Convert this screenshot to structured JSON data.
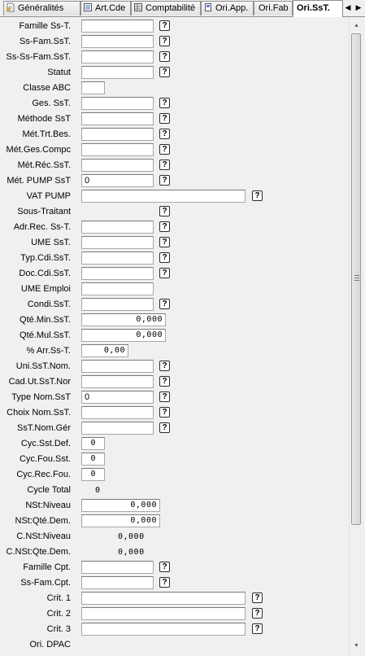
{
  "tabs": [
    {
      "label": "Généralités",
      "icon": "general-doc-icon",
      "active": false
    },
    {
      "label": "Art.Cde",
      "icon": "order-doc-icon",
      "active": false
    },
    {
      "label": "Comptabilité",
      "icon": "accounting-icon",
      "active": false
    },
    {
      "label": "Ori.App.",
      "icon": "supply-doc-icon",
      "active": false
    },
    {
      "label": "Ori.Fab",
      "icon": "",
      "active": false
    },
    {
      "label": "Ori.SsT.",
      "icon": "",
      "active": true
    }
  ],
  "tab_scroll": {
    "left": "◀",
    "right": "▶"
  },
  "help_glyph": "?",
  "scrollbar": {
    "up": "▲",
    "down": "▼"
  },
  "fields": [
    {
      "label": "Famille Ss-T.",
      "value": "",
      "help": true
    },
    {
      "label": "Ss-Fam.SsT.",
      "value": "",
      "help": true
    },
    {
      "label": "Ss-Ss-Fam.SsT.",
      "value": "",
      "help": true
    },
    {
      "label": "Statut",
      "value": "",
      "help": true
    },
    {
      "label": "Classe ABC",
      "value": ""
    },
    {
      "label": "Ges. SsT.",
      "value": "",
      "help": true
    },
    {
      "label": "Méthode SsT",
      "value": "",
      "help": true
    },
    {
      "label": "Mét.Trt.Bes.",
      "value": "",
      "help": true
    },
    {
      "label": "Mét.Ges.Compc",
      "value": "",
      "help": true
    },
    {
      "label": "Mét.Réc.SsT.",
      "value": "",
      "help": true
    },
    {
      "label": "Mét. PUMP SsT",
      "value": "0",
      "help": true
    },
    {
      "label": "VAT PUMP",
      "value": "",
      "help": true
    },
    {
      "label": "Sous-Traitant",
      "value": "",
      "help": true
    },
    {
      "label": "Adr.Rec. Ss-T.",
      "value": "",
      "help": true
    },
    {
      "label": "UME SsT.",
      "value": "",
      "help": true
    },
    {
      "label": "Typ.Cdi.SsT.",
      "value": "",
      "help": true
    },
    {
      "label": "Doc.Cdi.SsT.",
      "value": "",
      "help": true
    },
    {
      "label": "UME Emploi",
      "value": ""
    },
    {
      "label": "Condi.SsT.",
      "value": "",
      "help": true
    },
    {
      "label": "Qté.Min.SsT.",
      "value": "0,000"
    },
    {
      "label": "Qté.Mul.SsT.",
      "value": "0,000"
    },
    {
      "label": "% Arr.Ss-T.",
      "value": "0,00"
    },
    {
      "label": "Uni.SsT.Nom.",
      "value": "",
      "help": true
    },
    {
      "label": "Cad.Ut.SsT.Nor",
      "value": "",
      "help": true
    },
    {
      "label": "Type Nom.SsT",
      "value": "0",
      "help": true
    },
    {
      "label": "Choix Nom.SsT.",
      "value": "",
      "help": true
    },
    {
      "label": "SsT.Nom.Gér",
      "value": "",
      "help": true
    },
    {
      "label": "Cyc.Sst.Def.",
      "value": "0"
    },
    {
      "label": "Cyc.Fou.Sst.",
      "value": "0"
    },
    {
      "label": "Cyc.Rec.Fou.",
      "value": "0"
    },
    {
      "label": "Cycle Total",
      "value": "0"
    },
    {
      "label": "NSt:Niveau",
      "value": "0,000"
    },
    {
      "label": "NSt:Qté.Dem.",
      "value": "0,000"
    },
    {
      "label": "C.NSt:Niveau",
      "value": "0,000"
    },
    {
      "label": "C.NSt:Qte.Dem.",
      "value": "0,000"
    },
    {
      "label": "Famille Cpt.",
      "value": "",
      "help": true
    },
    {
      "label": "Ss-Fam.Cpt.",
      "value": "",
      "help": true
    },
    {
      "label": "Crit. 1",
      "value": "",
      "help": true
    },
    {
      "label": "Crit. 2",
      "value": "",
      "help": true
    },
    {
      "label": "Crit. 3",
      "value": "",
      "help": true
    },
    {
      "label": "Ori. DPAC",
      "value": ""
    }
  ]
}
